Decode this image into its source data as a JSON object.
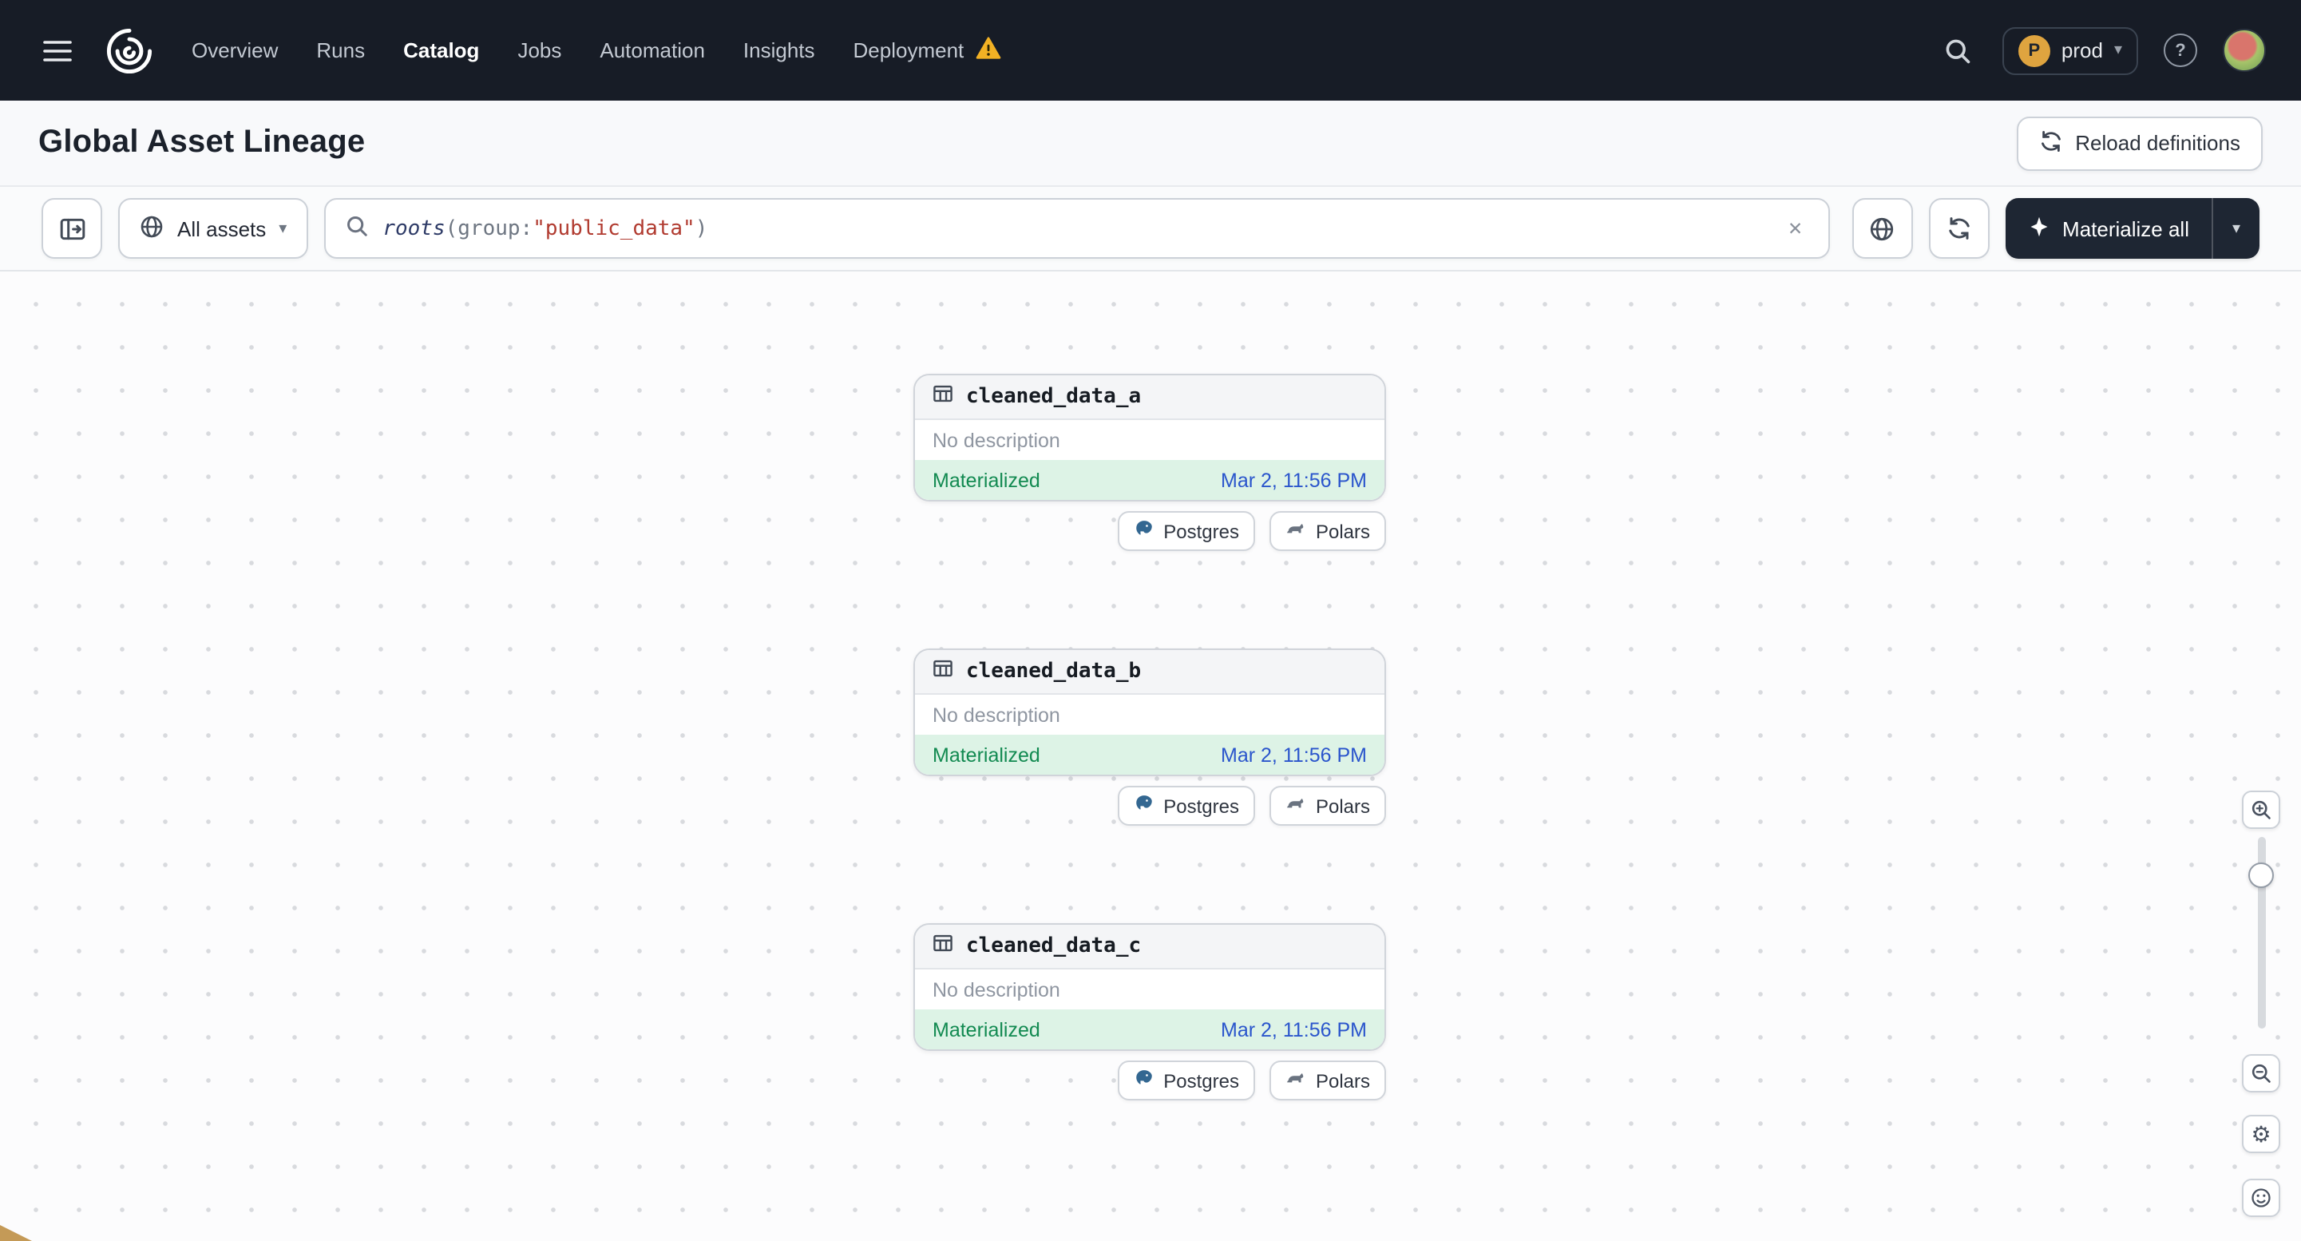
{
  "nav": {
    "items": [
      {
        "label": "Overview"
      },
      {
        "label": "Runs"
      },
      {
        "label": "Catalog"
      },
      {
        "label": "Jobs"
      },
      {
        "label": "Automation"
      },
      {
        "label": "Insights"
      },
      {
        "label": "Deployment"
      }
    ],
    "active_item": "Catalog",
    "deployment": {
      "initial": "P",
      "name": "prod"
    },
    "caret": "▾"
  },
  "page": {
    "title": "Global Asset Lineage",
    "reload_button": "Reload definitions"
  },
  "toolbar": {
    "filter": "All assets",
    "query": {
      "fn": "roots",
      "paren_open": "(",
      "key": "group:",
      "value": "\"public_data\"",
      "paren_close": ")"
    },
    "clear": "✕",
    "materialize": "Materialize all",
    "caret": "▾"
  },
  "graph": {
    "nodes": [
      {
        "name": "cleaned_data_a",
        "description": "No description",
        "status": "Materialized",
        "timestamp": "Mar 2, 11:56 PM",
        "tags": [
          "Postgres",
          "Polars"
        ]
      },
      {
        "name": "cleaned_data_b",
        "description": "No description",
        "status": "Materialized",
        "timestamp": "Mar 2, 11:56 PM",
        "tags": [
          "Postgres",
          "Polars"
        ]
      },
      {
        "name": "cleaned_data_c",
        "description": "No description",
        "status": "Materialized",
        "timestamp": "Mar 2, 11:56 PM",
        "tags": [
          "Postgres",
          "Polars"
        ]
      }
    ]
  },
  "controls": {
    "gear": "⚙"
  },
  "icons": {
    "menu": "hamburger",
    "search": "magnifier",
    "help": "?",
    "warning": "triangle-exclamation",
    "materialize": "sparkle",
    "clear": "✕"
  },
  "colors": {
    "nav_bg": "#171c26",
    "warning_amber": "#f2b124",
    "materialized_bg": "#ddf3e6",
    "materialized_text": "#128a51",
    "timestamp_text": "#2a55cc",
    "query_value": "#b13b30",
    "materialize_button_bg": "#1e2633",
    "postgres_blue": "#336791"
  }
}
